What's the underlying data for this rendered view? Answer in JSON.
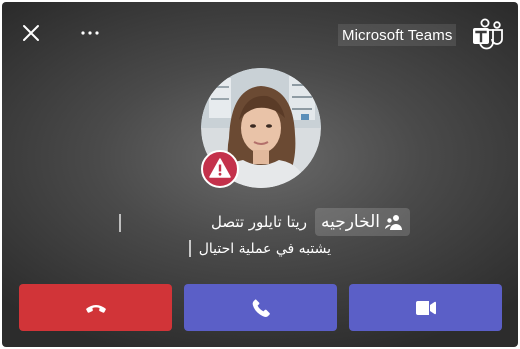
{
  "window": {
    "app_title": "Microsoft Teams"
  },
  "toolbar": {
    "close_icon": "close-icon",
    "more_icon": "more-options-icon"
  },
  "caller": {
    "external_label": "الخارجيه",
    "name_text": "ريتا تايلور تتصل",
    "fraud_warning": "يشتبه في عملية احتيال",
    "warning_icon": "warning-icon",
    "external_icon": "external-people-icon"
  },
  "actions": {
    "decline_icon": "hang-up-icon",
    "audio_icon": "phone-icon",
    "video_icon": "video-camera-icon"
  },
  "colors": {
    "decline": "#d13438",
    "accept": "#5b5fc7",
    "warning_badge": "#c4314b"
  }
}
